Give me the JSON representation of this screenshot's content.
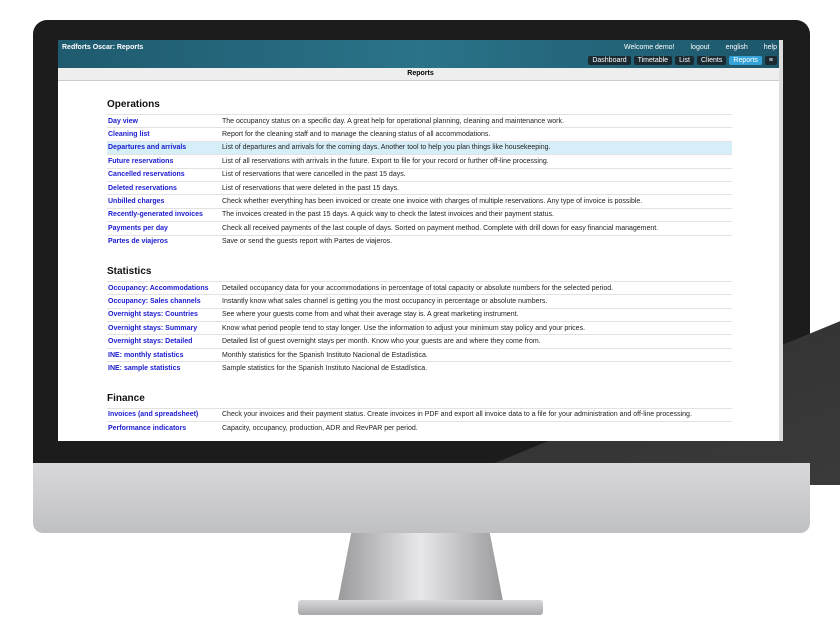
{
  "app": {
    "title": "Redforts Oscar: Reports",
    "welcome": "Welcome demo!",
    "logout": "logout",
    "language": "english",
    "help": "help"
  },
  "tabs": [
    {
      "label": "Dashboard"
    },
    {
      "label": "Timetable"
    },
    {
      "label": "List"
    },
    {
      "label": "Clients"
    },
    {
      "label": "Reports",
      "active": true
    },
    {
      "label": "≡"
    }
  ],
  "page_title": "Reports",
  "sections": [
    {
      "title": "Operations",
      "rows": [
        {
          "link": "Day view",
          "desc": "The occupancy status on a specific day. A great help for operational planning, cleaning and maintenance work."
        },
        {
          "link": "Cleaning list",
          "desc": "Report for the cleaning staff and to manage the cleaning status of all accommodations."
        },
        {
          "link": "Departures and arrivals",
          "desc": "List of departures and arrivals for the coming days. Another tool to help you plan things like housekeeping.",
          "highlighted": true
        },
        {
          "link": "Future reservations",
          "desc": "List of all reservations with arrivals in the future. Export to file for your record or further off-line processing."
        },
        {
          "link": "Cancelled reservations",
          "desc": "List of reservations that were cancelled in the past 15 days."
        },
        {
          "link": "Deleted reservations",
          "desc": "List of reservations that were deleted in the past 15 days."
        },
        {
          "link": "Unbilled charges",
          "desc": "Check whether everything has been invoiced or create one invoice with charges of multiple reservations. Any type of invoice is possible."
        },
        {
          "link": "Recently-generated invoices",
          "desc": "The invoices created in the past 15 days. A quick way to check the latest invoices and their payment status."
        },
        {
          "link": "Payments per day",
          "desc": "Check all received payments of the last couple of days. Sorted on payment method. Complete with drill down for easy financial management."
        },
        {
          "link": "Partes de viajeros",
          "desc": "Save or send the guests report with Partes de viajeros."
        }
      ]
    },
    {
      "title": "Statistics",
      "rows": [
        {
          "link": "Occupancy: Accommodations",
          "desc": "Detailed occupancy data for your accommodations in percentage of total capacity or absolute numbers for the selected period."
        },
        {
          "link": "Occupancy: Sales channels",
          "desc": "Instantly know what sales channel is getting you the most occupancy in percentage or absolute numbers."
        },
        {
          "link": "Overnight stays: Countries",
          "desc": "See where your guests come from and what their average stay is. A great marketing instrument."
        },
        {
          "link": "Overnight stays: Summary",
          "desc": "Know what period people tend to stay longer. Use the information to adjust your minimum stay policy and your prices."
        },
        {
          "link": "Overnight stays: Detailed",
          "desc": "Detailed list of guest overnight stays per month. Know who your guests are and where they come from."
        },
        {
          "link": "INE: monthly statistics",
          "desc": "Monthly statistics for the Spanish Instituto Nacional de Estadística."
        },
        {
          "link": "INE: sample statistics",
          "desc": "Sample statistics for the Spanish Instituto Nacional de Estadística."
        }
      ]
    },
    {
      "title": "Finance",
      "rows": [
        {
          "link": "Invoices (and spreadsheet)",
          "desc": "Check your invoices and their payment status. Create invoices in PDF and export all invoice data to a file for your administration and off-line processing."
        },
        {
          "link": "Performance indicators",
          "desc": "Capacity, occupancy, production, ADR and RevPAR per period."
        }
      ]
    }
  ],
  "colors": {
    "topbar": "#2a7389",
    "active_tab": "#35a3d8",
    "link": "#1a1ad0",
    "highlight_row": "#d6eef8"
  }
}
